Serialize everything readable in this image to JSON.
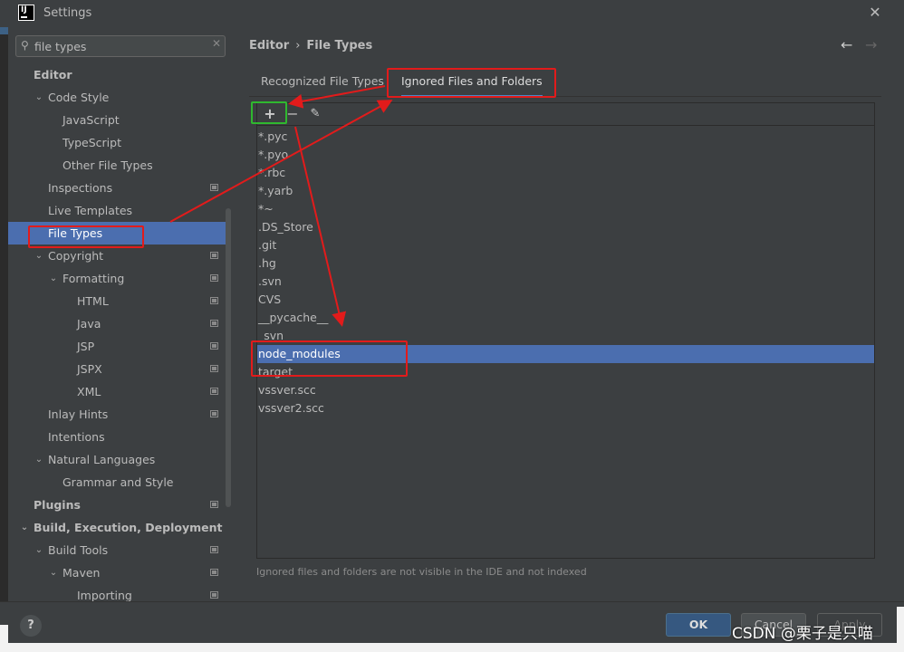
{
  "window": {
    "title": "Settings",
    "logo_text": "IJ"
  },
  "search": {
    "value": "file types",
    "placeholder": ""
  },
  "sidebar": {
    "items": [
      {
        "label": "Editor",
        "depth": 0,
        "bold": true,
        "chevron": "",
        "project": false,
        "selected": false
      },
      {
        "label": "Code Style",
        "depth": 1,
        "bold": false,
        "chevron": "down",
        "project": false,
        "selected": false
      },
      {
        "label": "JavaScript",
        "depth": 2,
        "bold": false,
        "chevron": "",
        "project": false,
        "selected": false
      },
      {
        "label": "TypeScript",
        "depth": 2,
        "bold": false,
        "chevron": "",
        "project": false,
        "selected": false
      },
      {
        "label": "Other File Types",
        "depth": 2,
        "bold": false,
        "chevron": "",
        "project": false,
        "selected": false
      },
      {
        "label": "Inspections",
        "depth": 1,
        "bold": false,
        "chevron": "",
        "project": true,
        "selected": false
      },
      {
        "label": "Live Templates",
        "depth": 1,
        "bold": false,
        "chevron": "",
        "project": false,
        "selected": false
      },
      {
        "label": "File Types",
        "depth": 1,
        "bold": false,
        "chevron": "",
        "project": false,
        "selected": true
      },
      {
        "label": "Copyright",
        "depth": 1,
        "bold": false,
        "chevron": "down",
        "project": true,
        "selected": false
      },
      {
        "label": "Formatting",
        "depth": 2,
        "bold": false,
        "chevron": "down",
        "project": true,
        "selected": false
      },
      {
        "label": "HTML",
        "depth": 3,
        "bold": false,
        "chevron": "",
        "project": true,
        "selected": false
      },
      {
        "label": "Java",
        "depth": 3,
        "bold": false,
        "chevron": "",
        "project": true,
        "selected": false
      },
      {
        "label": "JSP",
        "depth": 3,
        "bold": false,
        "chevron": "",
        "project": true,
        "selected": false
      },
      {
        "label": "JSPX",
        "depth": 3,
        "bold": false,
        "chevron": "",
        "project": true,
        "selected": false
      },
      {
        "label": "XML",
        "depth": 3,
        "bold": false,
        "chevron": "",
        "project": true,
        "selected": false
      },
      {
        "label": "Inlay Hints",
        "depth": 1,
        "bold": false,
        "chevron": "",
        "project": true,
        "selected": false
      },
      {
        "label": "Intentions",
        "depth": 1,
        "bold": false,
        "chevron": "",
        "project": false,
        "selected": false
      },
      {
        "label": "Natural Languages",
        "depth": 1,
        "bold": false,
        "chevron": "down",
        "project": false,
        "selected": false
      },
      {
        "label": "Grammar and Style",
        "depth": 2,
        "bold": false,
        "chevron": "",
        "project": false,
        "selected": false
      },
      {
        "label": "Plugins",
        "depth": 0,
        "bold": true,
        "chevron": "",
        "project": true,
        "selected": false
      },
      {
        "label": "Build, Execution, Deployment",
        "depth": 0,
        "bold": true,
        "chevron": "down",
        "project": false,
        "selected": false
      },
      {
        "label": "Build Tools",
        "depth": 1,
        "bold": false,
        "chevron": "down",
        "project": true,
        "selected": false
      },
      {
        "label": "Maven",
        "depth": 2,
        "bold": false,
        "chevron": "down",
        "project": true,
        "selected": false
      },
      {
        "label": "Importing",
        "depth": 3,
        "bold": false,
        "chevron": "",
        "project": true,
        "selected": false
      }
    ]
  },
  "breadcrumb": {
    "parent": "Editor",
    "separator": "›",
    "current": "File Types"
  },
  "nav": {
    "back_icon": "←",
    "forward_icon": "→"
  },
  "tabs": [
    {
      "label": "Recognized File Types",
      "active": false
    },
    {
      "label": "Ignored Files and Folders",
      "active": true
    }
  ],
  "toolbar": {
    "add_icon": "+",
    "remove_icon": "−",
    "edit_icon": "✎"
  },
  "ignore_list": [
    {
      "label": "*.pyc",
      "selected": false
    },
    {
      "label": "*.pyo",
      "selected": false
    },
    {
      "label": "*.rbc",
      "selected": false
    },
    {
      "label": "*.yarb",
      "selected": false
    },
    {
      "label": "*~",
      "selected": false
    },
    {
      "label": ".DS_Store",
      "selected": false
    },
    {
      "label": ".git",
      "selected": false
    },
    {
      "label": ".hg",
      "selected": false
    },
    {
      "label": ".svn",
      "selected": false
    },
    {
      "label": "CVS",
      "selected": false
    },
    {
      "label": "__pycache__",
      "selected": false
    },
    {
      "label": "_svn",
      "selected": false
    },
    {
      "label": "node_modules",
      "selected": true
    },
    {
      "label": "target",
      "selected": false
    },
    {
      "label": "vssver.scc",
      "selected": false
    },
    {
      "label": "vssver2.scc",
      "selected": false
    }
  ],
  "hint": "Ignored files and folders are not visible in the IDE and not indexed",
  "buttons": {
    "help": "?",
    "ok": "OK",
    "cancel": "Cancel",
    "apply": "Apply"
  },
  "watermark": "CSDN @栗子是只喵",
  "colors": {
    "background": "#3c3f41",
    "selection": "#4b6eaf",
    "accent_tab": "#4a88c7",
    "annotation_red": "#e21b1b",
    "annotation_green": "#2fb82f",
    "ok_button": "#365880"
  }
}
